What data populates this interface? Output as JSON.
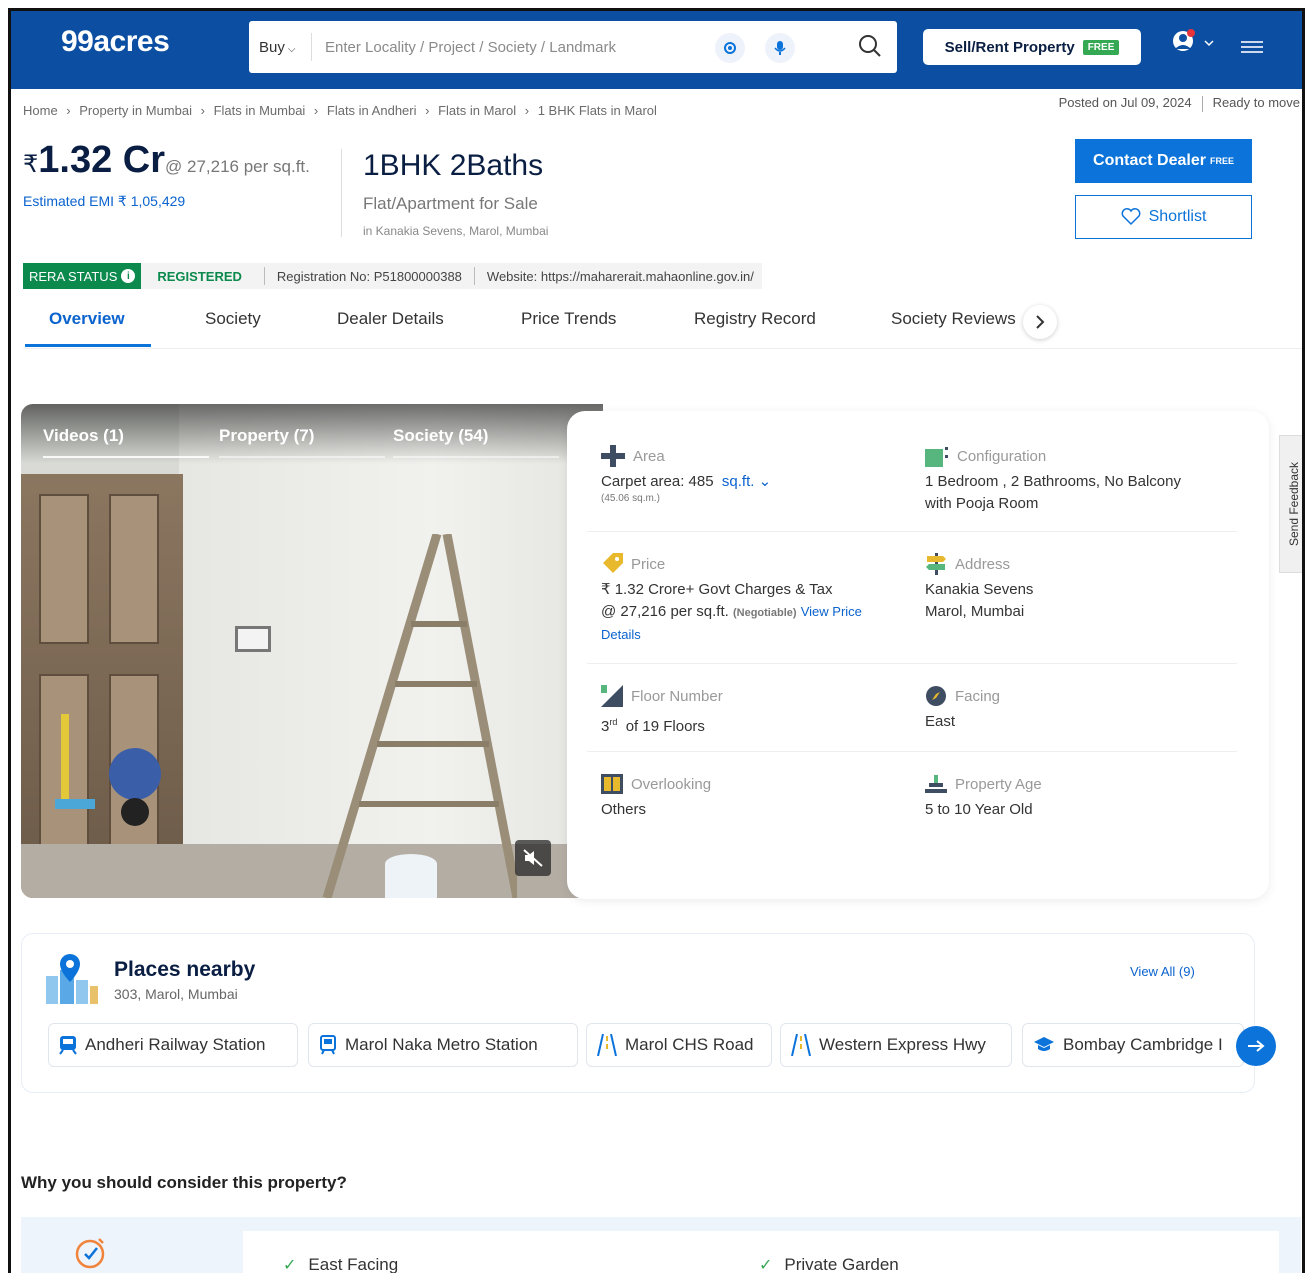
{
  "header": {
    "logo": "99acres",
    "search": {
      "type": "Buy",
      "placeholder": "Enter Locality / Project / Society / Landmark"
    },
    "sell_button": "Sell/Rent Property",
    "free_tag": "FREE"
  },
  "breadcrumbs": [
    "Home",
    "Property in Mumbai",
    "Flats in Mumbai",
    "Flats in Andheri",
    "Flats in Marol",
    "1 BHK Flats in Marol"
  ],
  "posted": "Posted on Jul 09, 2024",
  "status": "Ready to move",
  "listing": {
    "currency": "₹",
    "price": "1.32 Cr",
    "price_per_sqft": "@ 27,216 per sq.ft.",
    "emi": "Estimated EMI ₹ 1,05,429",
    "title": "1BHK 2Baths",
    "subtitle": "Flat/Apartment for Sale",
    "location": "in Kanakia Sevens, Marol, Mumbai",
    "contact_label": "Contact Dealer",
    "contact_free": "FREE",
    "shortlist_label": "Shortlist"
  },
  "rera": {
    "label": "RERA STATUS",
    "info": "i",
    "status": "REGISTERED",
    "registration": "Registration No: P51800000388",
    "website": "Website: https://maharerait.mahaonline.gov.in/"
  },
  "tabs": [
    "Overview",
    "Society",
    "Dealer Details",
    "Price Trends",
    "Registry Record",
    "Society Reviews"
  ],
  "media": {
    "tabs": [
      "Videos (1)",
      "Property (7)",
      "Society (54)"
    ]
  },
  "details": {
    "area": {
      "label": "Area",
      "value": "Carpet area: 485",
      "unit": "sq.ft.",
      "sub": "(45.06 sq.m.)"
    },
    "configuration": {
      "label": "Configuration",
      "line1": "1 Bedroom , 2 Bathrooms, No Balcony",
      "line2": "with Pooja Room"
    },
    "price": {
      "label": "Price",
      "line1": "₹ 1.32 Crore+ Govt Charges & Tax",
      "line2": "@ 27,216 per sq.ft.",
      "negotiable": "(Negotiable)",
      "link1": "View Price",
      "link2": "Details"
    },
    "address": {
      "label": "Address",
      "line1": "Kanakia Sevens",
      "line2": "Marol, Mumbai"
    },
    "floor": {
      "label": "Floor Number",
      "floor": "3",
      "suffix": "rd",
      "total": "of 19 Floors"
    },
    "facing": {
      "label": "Facing",
      "value": "East"
    },
    "overlooking": {
      "label": "Overlooking",
      "value": "Others"
    },
    "age": {
      "label": "Property Age",
      "value": "5 to 10 Year Old"
    }
  },
  "feedback": "Send Feedback",
  "places": {
    "title": "Places nearby",
    "address": "303, Marol, Mumbai",
    "view_all": "View All (9)",
    "items": [
      "Andheri Railway Station",
      "Marol Naka Metro Station",
      "Marol CHS Road",
      "Western Express Hwy",
      "Bombay Cambridge I"
    ]
  },
  "why": {
    "title": "Why you should consider this property?",
    "items": [
      "East Facing",
      "Private Garden"
    ]
  },
  "colors": {
    "brand_blue": "#0b4ea2",
    "accent_blue": "#0b73d9",
    "rera_green": "#0c8a4d"
  }
}
